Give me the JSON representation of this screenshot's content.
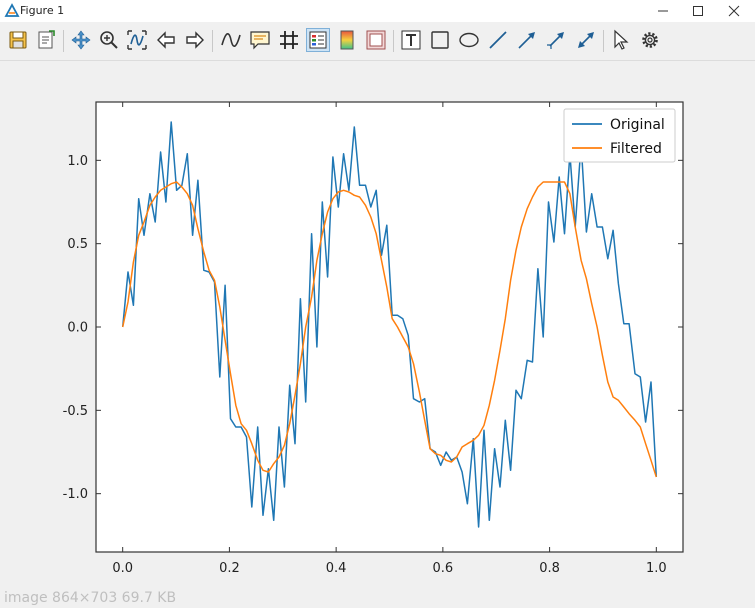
{
  "window": {
    "title": "Figure 1"
  },
  "icons": {
    "app": "matplotlib-icon",
    "minimize": "minimize-icon",
    "maximize": "maximize-icon",
    "close": "close-icon"
  },
  "toolbar": {
    "tools": [
      {
        "name": "save-icon"
      },
      {
        "name": "export-icon"
      },
      {
        "name": "pan-icon"
      },
      {
        "name": "zoom-icon"
      },
      {
        "name": "autoscale-icon"
      },
      {
        "name": "back-icon"
      },
      {
        "name": "forward-icon"
      },
      {
        "name": "curve-style-icon"
      },
      {
        "name": "annotate-icon"
      },
      {
        "name": "grid-icon"
      },
      {
        "name": "legend-icon"
      },
      {
        "name": "colormap-icon"
      },
      {
        "name": "frame-icon"
      },
      {
        "name": "text-icon"
      },
      {
        "name": "rectangle-icon"
      },
      {
        "name": "ellipse-icon"
      },
      {
        "name": "line-icon"
      },
      {
        "name": "arrow-icon"
      },
      {
        "name": "arrow-tail-icon"
      },
      {
        "name": "double-arrow-icon"
      },
      {
        "name": "select-icon"
      },
      {
        "name": "settings-icon"
      }
    ]
  },
  "status_text": "image  864×703 69.7 KB",
  "chart_data": {
    "type": "line",
    "title": "",
    "xlabel": "",
    "ylabel": "",
    "xlim": [
      -0.05,
      1.05
    ],
    "ylim": [
      -1.35,
      1.35
    ],
    "xticks": [
      "0.0",
      "0.2",
      "0.4",
      "0.6",
      "0.8",
      "1.0"
    ],
    "yticks": [
      "-1.0",
      "-0.5",
      "0.0",
      "0.5",
      "1.0"
    ],
    "grid": false,
    "legend": "top-right",
    "series": [
      {
        "name": "Original",
        "color": "#1f77b4",
        "x": [
          0.0,
          0.01,
          0.02,
          0.03,
          0.04,
          0.051,
          0.061,
          0.071,
          0.081,
          0.091,
          0.101,
          0.111,
          0.121,
          0.131,
          0.141,
          0.152,
          0.162,
          0.172,
          0.182,
          0.192,
          0.202,
          0.212,
          0.222,
          0.232,
          0.242,
          0.253,
          0.263,
          0.273,
          0.283,
          0.293,
          0.303,
          0.313,
          0.323,
          0.333,
          0.343,
          0.354,
          0.364,
          0.374,
          0.384,
          0.394,
          0.404,
          0.414,
          0.424,
          0.434,
          0.444,
          0.455,
          0.465,
          0.475,
          0.485,
          0.495,
          0.505,
          0.515,
          0.525,
          0.535,
          0.545,
          0.556,
          0.566,
          0.576,
          0.586,
          0.596,
          0.606,
          0.616,
          0.626,
          0.636,
          0.646,
          0.657,
          0.667,
          0.677,
          0.687,
          0.697,
          0.707,
          0.717,
          0.727,
          0.737,
          0.747,
          0.758,
          0.768,
          0.778,
          0.788,
          0.798,
          0.808,
          0.818,
          0.828,
          0.838,
          0.848,
          0.859,
          0.869,
          0.879,
          0.889,
          0.899,
          0.909,
          0.919,
          0.929,
          0.939,
          0.949,
          0.96,
          0.97,
          0.98,
          0.99,
          1.0
        ],
        "y": [
          0.0,
          0.33,
          0.13,
          0.77,
          0.55,
          0.8,
          0.63,
          1.05,
          0.75,
          1.23,
          0.82,
          0.85,
          1.04,
          0.55,
          0.88,
          0.34,
          0.33,
          0.27,
          -0.3,
          0.25,
          -0.55,
          -0.6,
          -0.6,
          -0.66,
          -1.08,
          -0.6,
          -1.13,
          -0.85,
          -1.16,
          -0.6,
          -0.96,
          -0.35,
          -0.7,
          0.17,
          -0.45,
          0.56,
          -0.12,
          0.75,
          0.3,
          1.02,
          0.72,
          1.04,
          0.82,
          1.2,
          0.85,
          0.85,
          0.72,
          0.82,
          0.43,
          0.61,
          0.07,
          0.07,
          0.05,
          -0.05,
          -0.43,
          -0.45,
          -0.43,
          -0.73,
          -0.75,
          -0.83,
          -0.75,
          -0.8,
          -0.78,
          -0.87,
          -1.06,
          -0.67,
          -1.2,
          -0.62,
          -1.16,
          -0.73,
          -0.96,
          -0.56,
          -0.86,
          -0.38,
          -0.43,
          -0.2,
          -0.21,
          0.35,
          -0.06,
          0.75,
          0.51,
          0.9,
          0.56,
          1.04,
          0.6,
          1.1,
          0.57,
          0.8,
          0.6,
          0.6,
          0.41,
          0.58,
          0.26,
          0.02,
          0.02,
          -0.28,
          -0.3,
          -0.57,
          -0.33,
          -0.9
        ]
      },
      {
        "name": "Filtered",
        "color": "#ff7f0e",
        "x": [
          0.0,
          0.01,
          0.02,
          0.03,
          0.04,
          0.051,
          0.061,
          0.071,
          0.081,
          0.091,
          0.101,
          0.111,
          0.121,
          0.131,
          0.141,
          0.152,
          0.162,
          0.172,
          0.182,
          0.192,
          0.202,
          0.212,
          0.222,
          0.232,
          0.242,
          0.253,
          0.263,
          0.273,
          0.283,
          0.293,
          0.303,
          0.313,
          0.323,
          0.333,
          0.343,
          0.354,
          0.364,
          0.374,
          0.384,
          0.394,
          0.404,
          0.414,
          0.424,
          0.434,
          0.444,
          0.455,
          0.465,
          0.475,
          0.485,
          0.495,
          0.505,
          0.515,
          0.525,
          0.535,
          0.545,
          0.556,
          0.566,
          0.576,
          0.586,
          0.596,
          0.606,
          0.616,
          0.626,
          0.636,
          0.646,
          0.657,
          0.667,
          0.677,
          0.687,
          0.697,
          0.707,
          0.717,
          0.727,
          0.737,
          0.747,
          0.758,
          0.768,
          0.778,
          0.788,
          0.798,
          0.808,
          0.818,
          0.828,
          0.838,
          0.848,
          0.859,
          0.869,
          0.879,
          0.889,
          0.899,
          0.909,
          0.919,
          0.929,
          0.939,
          0.949,
          0.96,
          0.97,
          0.98,
          0.99,
          1.0
        ],
        "y": [
          0.0,
          0.15,
          0.39,
          0.55,
          0.63,
          0.73,
          0.78,
          0.82,
          0.84,
          0.86,
          0.87,
          0.84,
          0.8,
          0.73,
          0.59,
          0.45,
          0.34,
          0.28,
          0.12,
          -0.08,
          -0.28,
          -0.47,
          -0.58,
          -0.62,
          -0.7,
          -0.8,
          -0.86,
          -0.87,
          -0.82,
          -0.78,
          -0.71,
          -0.58,
          -0.41,
          -0.22,
          0.0,
          0.18,
          0.4,
          0.56,
          0.69,
          0.77,
          0.81,
          0.82,
          0.81,
          0.79,
          0.78,
          0.73,
          0.66,
          0.56,
          0.4,
          0.24,
          0.05,
          0.0,
          -0.06,
          -0.12,
          -0.22,
          -0.39,
          -0.56,
          -0.73,
          -0.76,
          -0.77,
          -0.8,
          -0.81,
          -0.78,
          -0.72,
          -0.7,
          -0.68,
          -0.65,
          -0.59,
          -0.47,
          -0.32,
          -0.14,
          0.05,
          0.28,
          0.46,
          0.6,
          0.71,
          0.78,
          0.84,
          0.87,
          0.87,
          0.87,
          0.87,
          0.87,
          0.8,
          0.6,
          0.4,
          0.29,
          0.14,
          0.0,
          -0.17,
          -0.33,
          -0.42,
          -0.44,
          -0.48,
          -0.52,
          -0.56,
          -0.6,
          -0.7,
          -0.8,
          -0.9
        ]
      }
    ]
  }
}
